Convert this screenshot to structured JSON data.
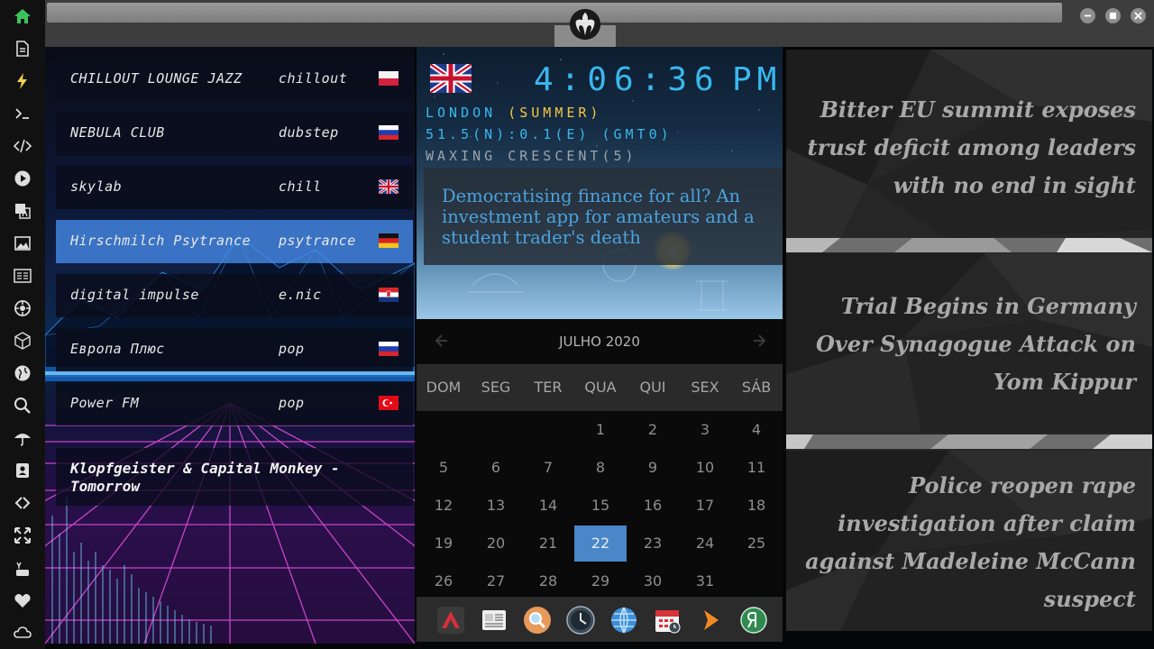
{
  "sidebar": {
    "icons": [
      "home-icon",
      "document-icon",
      "lightning-icon",
      "terminal-icon",
      "code-icon",
      "play-icon",
      "translate-icon",
      "image-icon",
      "news-icon",
      "settings-gear-icon",
      "cube-icon",
      "globe-icon",
      "search-icon",
      "umbrella-icon",
      "contact-icon",
      "link-icon",
      "expand-icon",
      "youtube-icon",
      "heart-icon",
      "cloud-icon"
    ]
  },
  "window": {
    "logo": "rebel-alliance-icon",
    "controls": [
      "minimize-icon",
      "maximize-icon",
      "close-icon"
    ]
  },
  "radio": {
    "stations": [
      {
        "name": "CHILLOUT LOUNGE JAZZ",
        "genre": "chillout",
        "flag": "poland"
      },
      {
        "name": "NEBULA CLUB",
        "genre": "dubstep",
        "flag": "russia"
      },
      {
        "name": "skylab",
        "genre": "chill",
        "flag": "united-kingdom"
      },
      {
        "name": "Hirschmilch Psytrance",
        "genre": "psytrance",
        "flag": "germany"
      },
      {
        "name": "digital impulse",
        "genre": "e.nic",
        "flag": "croatia"
      },
      {
        "name": "Европа Плюс",
        "genre": "pop",
        "flag": "russia"
      },
      {
        "name": "Power FM",
        "genre": "pop",
        "flag": "turkey"
      }
    ],
    "active_index": 3,
    "now_playing": "Klopfgeister & Capital Monkey - Tomorrow"
  },
  "clock": {
    "flag": "united-kingdom",
    "time": "4:06:36",
    "ampm": "PM",
    "city": "LONDON ",
    "season": "(SUMMER)",
    "coords": "51.5(N):0.1(E) (GMT0)",
    "moon": "WAXING CRESCENT(5)",
    "headline": "Democratising finance for all? An investment app for amateurs and a student trader's death"
  },
  "calendar": {
    "title": "JULHO 2020",
    "weekdays": [
      "DOM",
      "SEG",
      "TER",
      "QUA",
      "QUI",
      "SEX",
      "SÁB"
    ],
    "weeks": [
      [
        "",
        "",
        "",
        "1",
        "2",
        "3",
        "4"
      ],
      [
        "5",
        "6",
        "7",
        "8",
        "9",
        "10",
        "11"
      ],
      [
        "12",
        "13",
        "14",
        "15",
        "16",
        "17",
        "18"
      ],
      [
        "19",
        "20",
        "21",
        "22",
        "23",
        "24",
        "25"
      ],
      [
        "26",
        "27",
        "28",
        "29",
        "30",
        "31",
        ""
      ]
    ],
    "today": "22"
  },
  "dock": {
    "apps": [
      "app-launcher-icon",
      "news-reader-icon",
      "search-app-icon",
      "clock-app-icon",
      "browser-globe-icon",
      "calendar-app-icon",
      "arrow-app-icon",
      "yandex-icon"
    ]
  },
  "news": {
    "items": [
      "Bitter EU summit exposes trust deficit among leaders with no end in sight",
      "Trial Begins in Germany Over Synagogue Attack on Yom Kippur",
      "Police reopen rape investigation after claim against Madeleine McCann suspect"
    ]
  },
  "colors": {
    "accent_blue": "#4a86c8",
    "lcd_blue": "#39b8ee",
    "lcd_season": "#f5c640",
    "headline_blue": "#4aa3df",
    "active_station": "#468ceb"
  }
}
